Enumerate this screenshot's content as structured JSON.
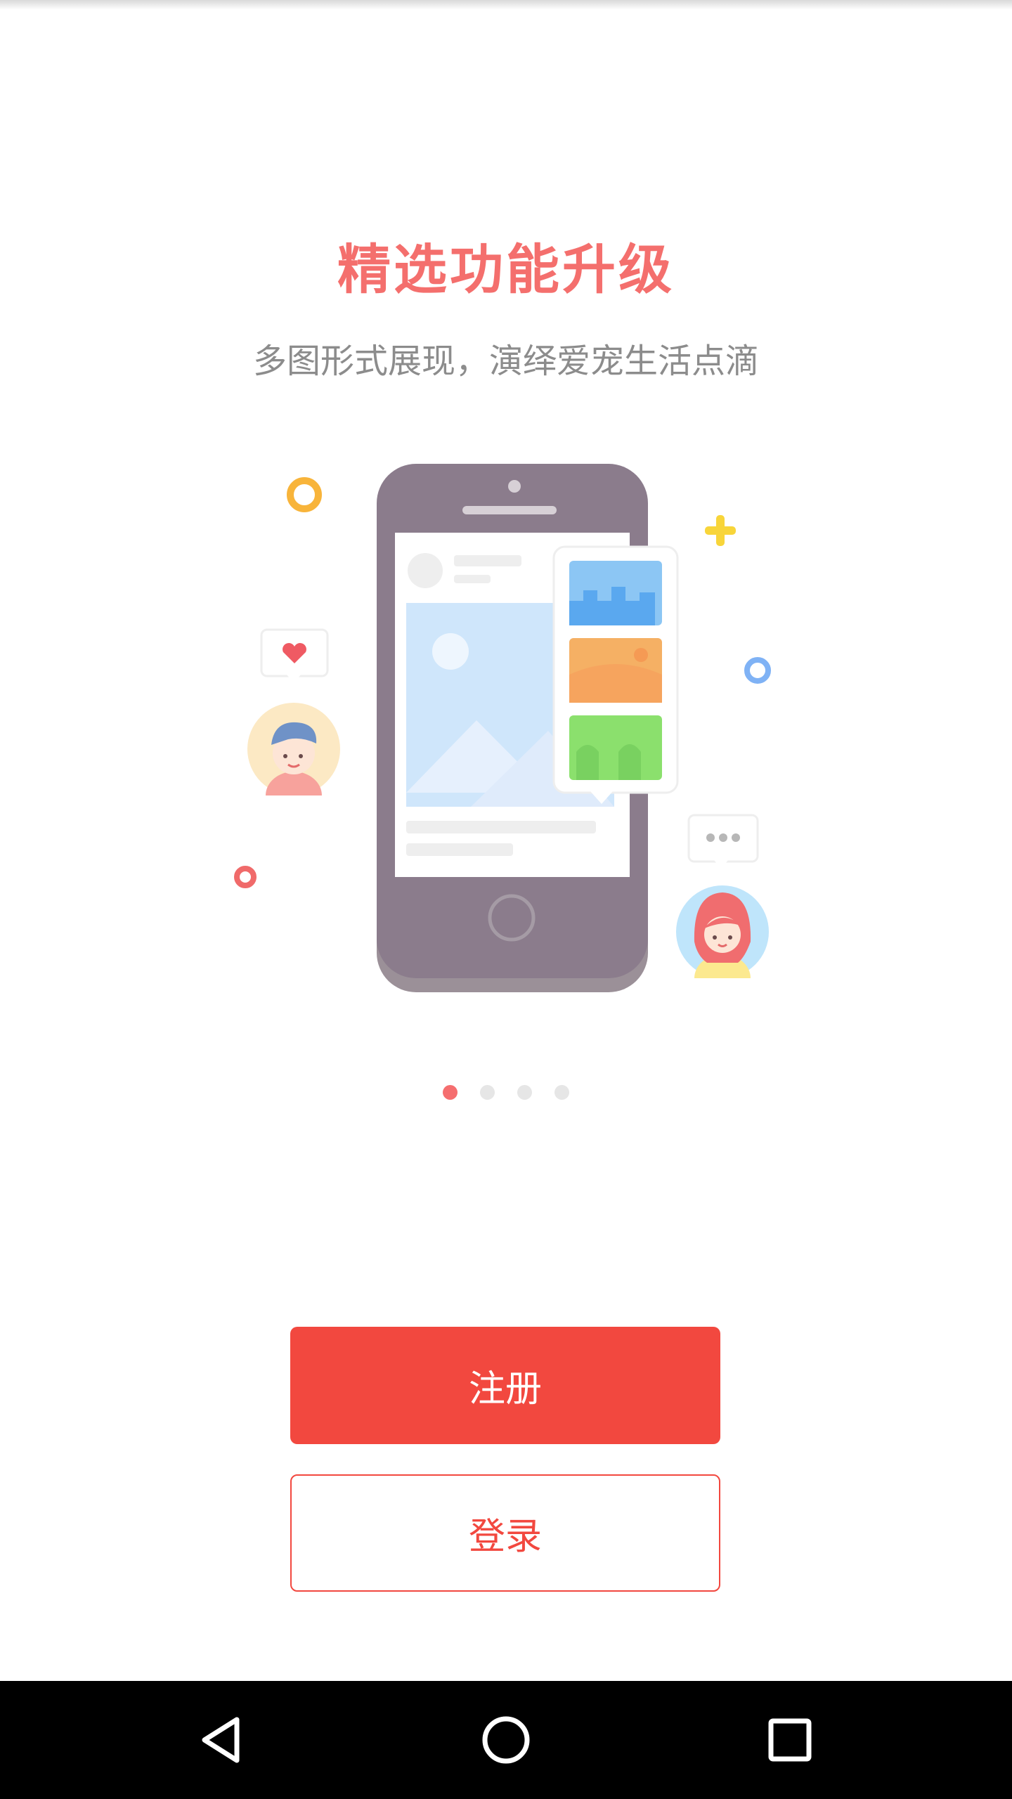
{
  "onboarding": {
    "title": "精选功能升级",
    "subtitle": "多图形式展现，演绎爱宠生活点滴",
    "illustration": "phone-photo-gallery-illustration",
    "page_indicator": {
      "total": 4,
      "active_index": 0
    }
  },
  "actions": {
    "register_label": "注册",
    "login_label": "登录"
  },
  "navbar": {
    "back_icon": "triangle-back-icon",
    "home_icon": "circle-home-icon",
    "recents_icon": "square-recents-icon"
  },
  "colors": {
    "accent": "#f2483f",
    "title": "#f46f6d",
    "subtitle": "#8c8c8c",
    "dot_active": "#f56e6f",
    "dot_inactive": "#e6e6e6"
  }
}
